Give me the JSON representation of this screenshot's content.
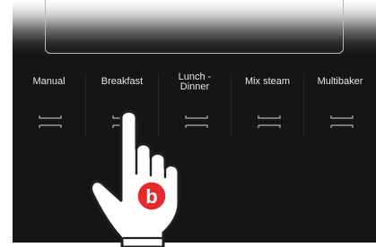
{
  "modes": [
    {
      "label": "Manual"
    },
    {
      "label": "Breakfast"
    },
    {
      "label": "Lunch - Dinner"
    },
    {
      "label": "Mix steam"
    },
    {
      "label": "Multibaker"
    }
  ],
  "badge": {
    "letter": "b"
  },
  "colors": {
    "background": "#151515",
    "label": "#e6e6e6",
    "icon": "#9a9a9a",
    "badge": "#e42a2a"
  }
}
